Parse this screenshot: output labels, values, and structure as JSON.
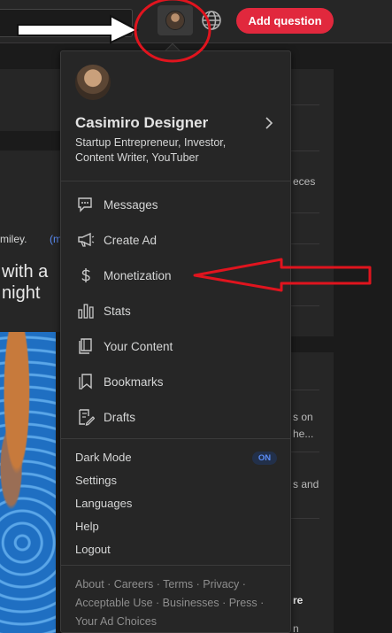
{
  "topbar": {
    "add_question_label": "Add question",
    "avatar_icon": "user-avatar",
    "globe_icon": "globe-icon"
  },
  "background": {
    "text_smiley": "miley.",
    "text_more": "(m",
    "text_with_a": "with a",
    "text_night": "night",
    "right_texts": [
      "eces",
      "s on",
      "he...",
      "s and",
      "re",
      "n"
    ]
  },
  "menu": {
    "profile": {
      "name": "Casimiro Designer",
      "bio": "Startup Entrepreneur, Investor, Content Writer, YouTuber"
    },
    "items": [
      {
        "label": "Messages",
        "icon": "messages-icon"
      },
      {
        "label": "Create Ad",
        "icon": "megaphone-icon"
      },
      {
        "label": "Monetization",
        "icon": "dollar-icon"
      },
      {
        "label": "Stats",
        "icon": "stats-icon"
      },
      {
        "label": "Your Content",
        "icon": "content-icon"
      },
      {
        "label": "Bookmarks",
        "icon": "bookmark-icon"
      },
      {
        "label": "Drafts",
        "icon": "drafts-icon"
      }
    ],
    "dark_mode": {
      "label": "Dark Mode",
      "status": "ON"
    },
    "settings_items": [
      "Settings",
      "Languages",
      "Help",
      "Logout"
    ],
    "footer_links": [
      "About",
      "Careers",
      "Terms",
      "Privacy",
      "Acceptable Use",
      "Businesses",
      "Press",
      "Your Ad Choices"
    ]
  },
  "colors": {
    "accent": "#e1283d",
    "annotation": "#e0141e",
    "background": "#1b1b1b",
    "surface": "#262626",
    "on_badge_text": "#5b8cf5"
  }
}
